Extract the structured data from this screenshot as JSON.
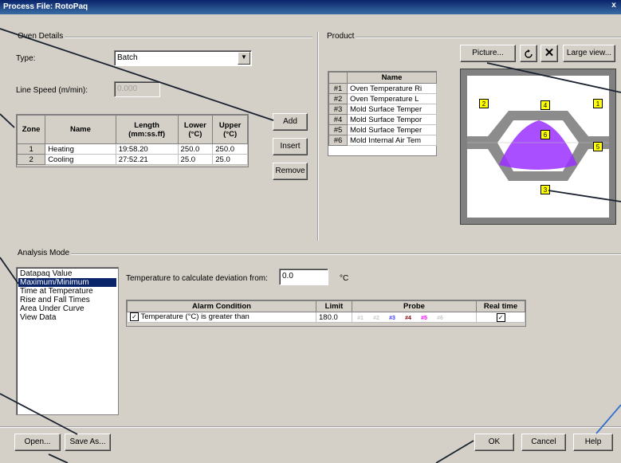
{
  "window": {
    "title": "Process File: RotoPaq",
    "close_glyph": "x"
  },
  "oven": {
    "group_label": "Oven Details",
    "type_label": "Type:",
    "type_value": "Batch",
    "line_speed_label": "Line Speed (m/min):",
    "line_speed_value": "0.000",
    "columns": [
      "Zone",
      "Name",
      "Length (mm:ss.ff)",
      "Lower (°C)",
      "Upper (°C)"
    ],
    "rows": [
      {
        "zone": "1",
        "name": "Heating",
        "length": "19:58.20",
        "lower": "250.0",
        "upper": "250.0"
      },
      {
        "zone": "2",
        "name": "Cooling",
        "length": "27:52.21",
        "lower": "25.0",
        "upper": "25.0"
      }
    ],
    "buttons": {
      "add": "Add",
      "insert": "Insert",
      "remove": "Remove"
    }
  },
  "product": {
    "group_label": "Product",
    "name_header": "Name",
    "items": [
      {
        "num": "#1",
        "name": "Oven Temperature Ri"
      },
      {
        "num": "#2",
        "name": "Oven Temperature L"
      },
      {
        "num": "#3",
        "name": "Mold Surface Temper"
      },
      {
        "num": "#4",
        "name": "Mold Surface Tempor"
      },
      {
        "num": "#5",
        "name": "Mold Surface Temper"
      },
      {
        "num": "#6",
        "name": "Mold Internal Air Tem"
      }
    ],
    "picture_button": "Picture...",
    "large_view_button": "Large view...",
    "markers": [
      "1",
      "2",
      "3",
      "4",
      "5",
      "6"
    ]
  },
  "analysis": {
    "group_label": "Analysis Mode",
    "modes": [
      "Datapaq Value",
      "Maximum/Minimum",
      "Time at Temperature",
      "Rise and Fall Times",
      "Area Under Curve",
      "View Data"
    ],
    "selected_mode": "Maximum/Minimum",
    "deviation_label": "Temperature to calculate deviation from:",
    "deviation_value": "0.0",
    "deviation_unit": "°C",
    "alarm_headers": {
      "condition": "Alarm Condition",
      "limit": "Limit",
      "probe": "Probe",
      "realtime": "Real time"
    },
    "alarm_condition": "Temperature (°C) is greater than",
    "alarm_limit": "180.0",
    "probe_labels": [
      "#1",
      "#2",
      "#3",
      "#4",
      "#5",
      "#6"
    ],
    "probe_colors": [
      "#c8c8c8",
      "#c8c8c8",
      "#3c3cff",
      "#800000",
      "#ff00ff",
      "#c8c8c8"
    ]
  },
  "footer": {
    "open": "Open...",
    "save_as": "Save As...",
    "ok": "OK",
    "cancel": "Cancel",
    "help": "Help"
  },
  "colors": {
    "title_bar": "#0a246a",
    "selection": "#0a246a",
    "product_fill": "#9b30ff",
    "marker": "#ffff00"
  }
}
